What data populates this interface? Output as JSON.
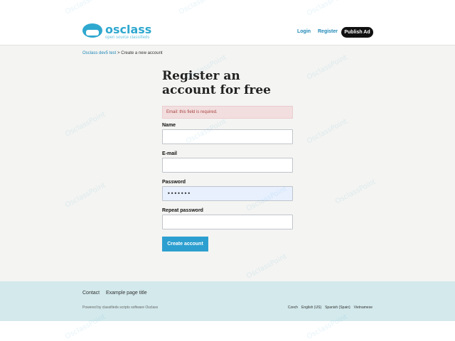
{
  "header": {
    "logo_text": "osclass",
    "logo_tagline": "open source classifieds",
    "login_label": "Login",
    "register_label": "Register",
    "publish_label": "Publish Ad"
  },
  "breadcrumb": {
    "home": "Osclass dev5 test",
    "separator": ">",
    "current": "Create a new account"
  },
  "form": {
    "title": "Register an account for free",
    "error": "Email: this field is required.",
    "name_label": "Name",
    "name_value": "",
    "email_label": "E-mail",
    "email_value": "",
    "password_label": "Password",
    "password_value": "•••••••",
    "repeat_password_label": "Repeat password",
    "repeat_password_value": "",
    "submit_label": "Create account"
  },
  "footer": {
    "links": [
      "Contact",
      "Example page title"
    ],
    "powered_by": "Powered by classifieds scripts software Osclass",
    "languages": [
      "Czech",
      "English (US)",
      "Spanish (Spain)",
      "Vietnamese"
    ]
  },
  "watermark": "OsclassPoint",
  "colors": {
    "accent": "#2c9fd0",
    "link": "#1f88b7",
    "error_bg": "#f2dede",
    "error_text": "#a94442",
    "footer_bg": "#d3e9ec"
  }
}
